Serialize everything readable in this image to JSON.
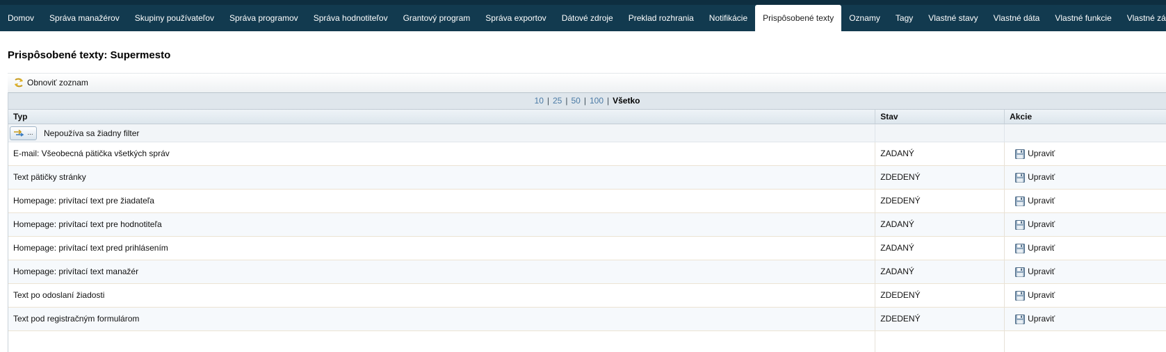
{
  "nav": {
    "tabs": [
      {
        "label": "Domov"
      },
      {
        "label": "Správa manažérov"
      },
      {
        "label": "Skupiny používateľov"
      },
      {
        "label": "Správa programov"
      },
      {
        "label": "Správa hodnotiteľov"
      },
      {
        "label": "Grantový program"
      },
      {
        "label": "Správa exportov"
      },
      {
        "label": "Dátové zdroje"
      },
      {
        "label": "Preklad rozhrania"
      },
      {
        "label": "Notifikácie"
      },
      {
        "label": "Prispôsobené texty"
      },
      {
        "label": "Oznamy"
      },
      {
        "label": "Tagy"
      },
      {
        "label": "Vlastné stavy"
      },
      {
        "label": "Vlastné dáta"
      },
      {
        "label": "Vlastné funkcie"
      },
      {
        "label": "Vlastné záložky"
      }
    ],
    "active_index": 10,
    "bar_color": "#123a4f"
  },
  "page": {
    "title": "Prispôsobené texty: Supermesto"
  },
  "toolbar": {
    "refresh_label": "Obnoviť zoznam",
    "refresh_icon": "refresh-arrow-icon"
  },
  "pager": {
    "sizes": [
      "10",
      "25",
      "50",
      "100"
    ],
    "current": "Všetko"
  },
  "grid": {
    "columns": {
      "type": "Typ",
      "state": "Stav",
      "actions": "Akcie"
    },
    "filter_button_label": "...",
    "filter_text": "Nepoužíva sa žiadny filter",
    "edit_label": "Upraviť",
    "edit_icon": "floppy-disk-icon",
    "rows": [
      {
        "type": "E-mail: Všeobecná pätička všetkých správ",
        "state": "ZADANÝ"
      },
      {
        "type": "Text pätičky stránky",
        "state": "ZDEDENÝ"
      },
      {
        "type": "Homepage: privítací text pre žiadateľa",
        "state": "ZDEDENÝ"
      },
      {
        "type": "Homepage: privítací text pre hodnotiteľa",
        "state": "ZADANÝ"
      },
      {
        "type": "Homepage: privítací text pred prihlásením",
        "state": "ZADANÝ"
      },
      {
        "type": "Homepage: privítací text manažér",
        "state": "ZADANÝ"
      },
      {
        "type": "Text po odoslaní žiadosti",
        "state": "ZDEDENÝ"
      },
      {
        "type": "Text pod registračným formulárom",
        "state": "ZDEDENÝ"
      },
      {
        "type": "",
        "state": ""
      }
    ]
  }
}
